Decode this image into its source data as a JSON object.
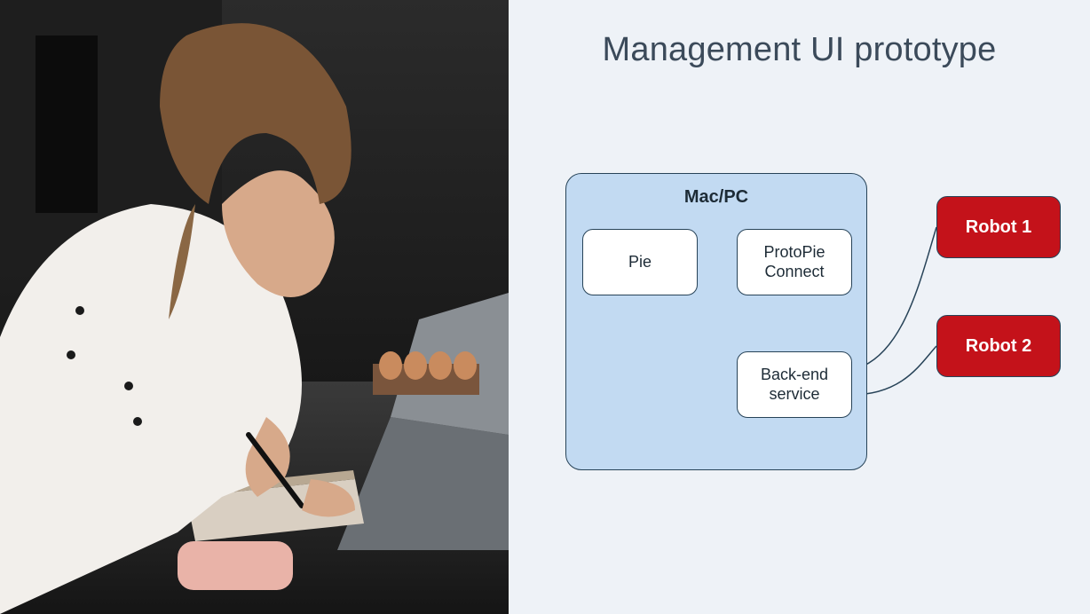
{
  "title": "Management UI prototype",
  "left_image_alt": "Person in chef coat writing in notebook next to a laptop",
  "diagram": {
    "container_label": "Mac/PC",
    "nodes": {
      "pie": "Pie",
      "protopie": "ProtoPie Connect",
      "backend": "Back-end service",
      "robot1": "Robot 1",
      "robot2": "Robot 2"
    },
    "edges": [
      {
        "from": "pie",
        "to": "protopie",
        "style": "line"
      },
      {
        "from": "protopie",
        "to": "backend",
        "style": "double-arrow"
      },
      {
        "from": "backend",
        "to": "robot1",
        "style": "curve"
      },
      {
        "from": "backend",
        "to": "robot2",
        "style": "curve"
      }
    ],
    "colors": {
      "container_fill": "#c2daf2",
      "node_fill": "#ffffff",
      "robot_fill": "#c4121a",
      "stroke": "#274358",
      "background": "#eef2f7"
    }
  }
}
